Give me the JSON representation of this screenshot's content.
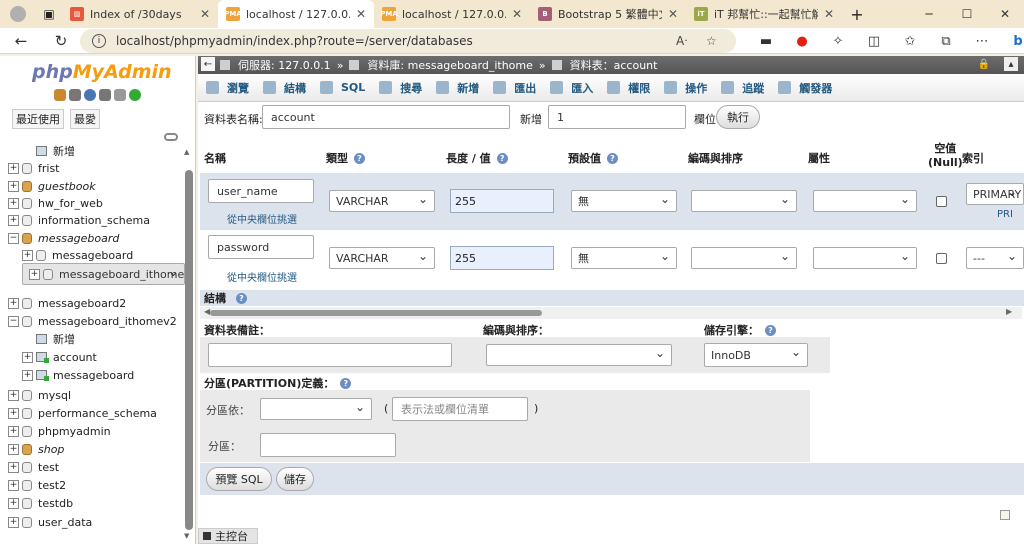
{
  "browser": {
    "tabs": [
      {
        "title": "Index of /30days",
        "favicon": "codepen-favicon",
        "active": false
      },
      {
        "title": "localhost / 127.0.0.1 / me",
        "favicon": "pma-favicon",
        "active": true
      },
      {
        "title": "localhost / 127.0.0.1 / me",
        "favicon": "pma-favicon",
        "active": false
      },
      {
        "title": "Bootstrap 5 繁體中文文",
        "favicon": "bootstrap-favicon",
        "active": false
      },
      {
        "title": "iT 邦幫忙::一起幫忙解決",
        "favicon": "ithelp-favicon",
        "active": false
      }
    ],
    "new_tab": "+",
    "url": "localhost/phpmyadmin/index.php?route=/server/databases"
  },
  "sidebar": {
    "logo_php": "php",
    "logo_myadmin": "MyAdmin",
    "tabs": [
      "最近使用",
      "最愛"
    ],
    "tree": [
      {
        "label": "新增",
        "kind": "new",
        "indent": 1
      },
      {
        "label": "frist",
        "kind": "db",
        "indent": 0
      },
      {
        "label": "guestbook",
        "kind": "db-stack",
        "indent": 0,
        "italic": true
      },
      {
        "label": "hw_for_web",
        "kind": "db",
        "indent": 0
      },
      {
        "label": "information_schema",
        "kind": "db",
        "indent": 0
      },
      {
        "label": "messageboard",
        "kind": "db-stack",
        "indent": 0,
        "italic": true,
        "expanded": true
      },
      {
        "label": "messageboard",
        "kind": "db",
        "indent": 1
      },
      {
        "label": "messageboard_ithome",
        "kind": "db",
        "indent": 1,
        "selected": true
      },
      {
        "label": "messageboard2",
        "kind": "db",
        "indent": 0
      },
      {
        "label": "messageboard_ithomev2",
        "kind": "db",
        "indent": 0,
        "expanded": true
      },
      {
        "label": "新增",
        "kind": "new",
        "indent": 1
      },
      {
        "label": "account",
        "kind": "table",
        "indent": 1
      },
      {
        "label": "messageboard",
        "kind": "table",
        "indent": 1
      },
      {
        "label": "mysql",
        "kind": "db",
        "indent": 0
      },
      {
        "label": "performance_schema",
        "kind": "db",
        "indent": 0
      },
      {
        "label": "phpmyadmin",
        "kind": "db",
        "indent": 0
      },
      {
        "label": "shop",
        "kind": "db-stack",
        "indent": 0,
        "italic": true
      },
      {
        "label": "test",
        "kind": "db",
        "indent": 0
      },
      {
        "label": "test2",
        "kind": "db",
        "indent": 0
      },
      {
        "label": "testdb",
        "kind": "db",
        "indent": 0
      },
      {
        "label": "user_data",
        "kind": "db",
        "indent": 0
      }
    ]
  },
  "breadcrumb": {
    "server": "伺服器: 127.0.0.1",
    "database": "資料庫: messageboard_ithome",
    "table": "資料表：account",
    "sep": "»"
  },
  "menu": [
    "瀏覽",
    "結構",
    "SQL",
    "搜尋",
    "新增",
    "匯出",
    "匯入",
    "權限",
    "操作",
    "追蹤",
    "觸發器"
  ],
  "form": {
    "table_name_label": "資料表名稱:",
    "table_name_value": "account",
    "add_label": "新增",
    "add_value": "1",
    "column_label": "欄位",
    "execute_button": "執行"
  },
  "columns_header": {
    "name": "名稱",
    "type": "類型",
    "length": "長度 / 值",
    "default": "預設值",
    "collation": "編碼與排序",
    "attributes": "屬性",
    "null": "空值\n(Null)",
    "index": "索引"
  },
  "rows": [
    {
      "name": "user_name",
      "type": "VARCHAR",
      "length": "255",
      "default": "無",
      "index": "PRIMARY",
      "index_sub": "PRI",
      "pick": "從中央欄位挑選"
    },
    {
      "name": "password",
      "type": "VARCHAR",
      "length": "255",
      "default": "無",
      "index": "---",
      "pick": "從中央欄位挑選"
    }
  ],
  "structure_label": "結構",
  "table_comment": {
    "comment_label": "資料表備註：",
    "collation_label": "編碼與排序：",
    "engine_label": "儲存引擎：",
    "engine_value": "InnoDB"
  },
  "partition": {
    "title": "分區(PARTITION)定義：",
    "by_label": "分區依：",
    "expr_placeholder": "表示法或欄位清單",
    "paren_open": "(",
    "paren_close": ")",
    "partitions_label": "分區："
  },
  "buttons": {
    "preview_sql": "預覽 SQL",
    "save": "儲存"
  },
  "footer": {
    "console": "主控台"
  }
}
